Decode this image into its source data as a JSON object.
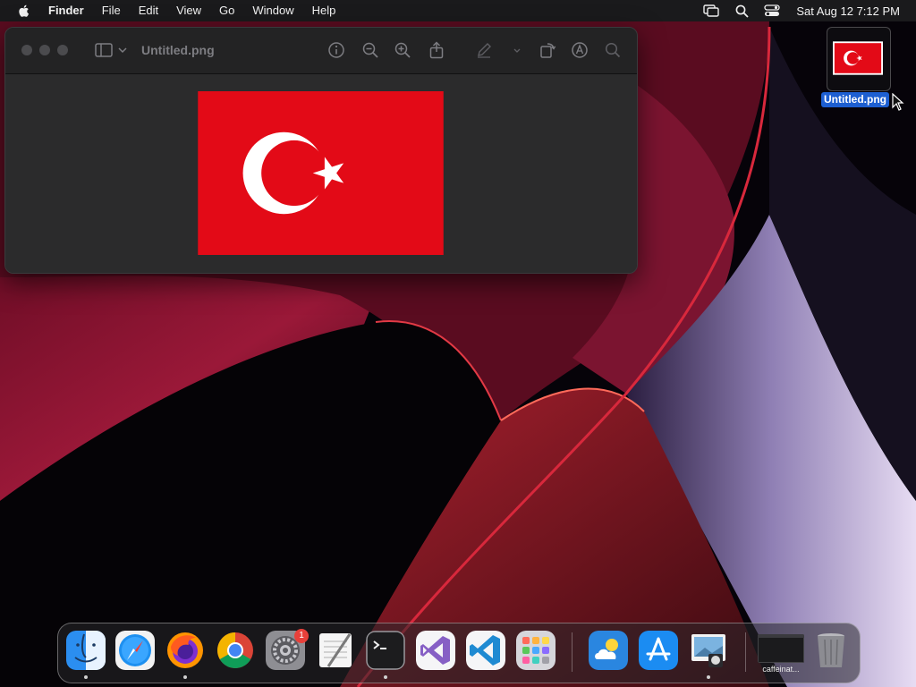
{
  "menubar": {
    "apple_icon": "apple-logo",
    "app_name": "Finder",
    "menus": [
      "File",
      "Edit",
      "View",
      "Go",
      "Window",
      "Help"
    ],
    "status_icons": [
      "screen-mirroring-icon",
      "search-icon",
      "control-center-icon"
    ],
    "clock": "Sat Aug 12  7:12 PM"
  },
  "preview_window": {
    "title": "Untitled.png",
    "toolbar_icons": [
      "sidebar-icon",
      "chevron-down-icon",
      "info-icon",
      "zoom-out-icon",
      "zoom-in-icon",
      "share-icon",
      "markup-pen-icon",
      "more-chevron-icon",
      "rotate-icon",
      "markup-icon",
      "search-icon"
    ],
    "image": {
      "subject": "turkish-flag",
      "colors": {
        "red": "#E30A17",
        "white": "#FFFFFF"
      }
    }
  },
  "desktop": {
    "file_icon_label": "Untitled.png"
  },
  "dock": {
    "apps": [
      "Finder",
      "Safari",
      "Firefox",
      "Google Chrome",
      "System Settings",
      "TextEdit",
      "Terminal",
      "Visual Studio",
      "Visual Studio Code",
      "Launchpad",
      "Weather",
      "App Store",
      "Preview"
    ],
    "settings_badge": "1",
    "minimized_label": "caffeinat...",
    "trash": "Trash"
  },
  "colors": {
    "menubar": "#1A1A1C",
    "selection": "#1D5FD1",
    "badge": "#E8403A"
  }
}
